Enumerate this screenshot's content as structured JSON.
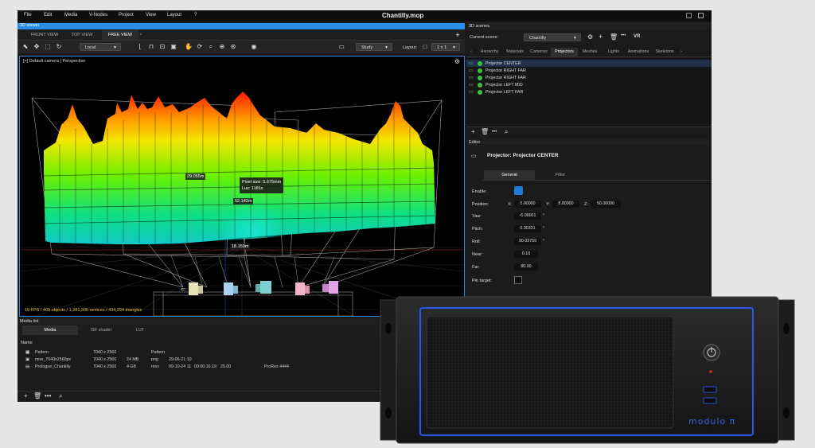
{
  "menu": {
    "items": [
      "File",
      "Edit",
      "Media",
      "V-Nodes",
      "Project",
      "View",
      "Layout",
      "?"
    ],
    "window_title": "Chantilly.mop"
  },
  "viewer": {
    "panel_title": "3D viewer",
    "tabs": [
      "FRONT VIEW",
      "TOP VIEW",
      "FREE VIEW"
    ],
    "space_dropdown": "Local",
    "mode_dropdown": "Study",
    "layout_label": "Layout:",
    "layout_dropdown": "1 x 1",
    "camera_label": "[+] Default camera | Perspective",
    "stats": "19 FPS / 409 objects / 1,281,305 vertices / 434,294 triangles",
    "measures": [
      "29.055m",
      "52.142m",
      "18.159m"
    ],
    "pixel_size": "Pixel size: 5.675mm",
    "lux": "Lux: 1181x"
  },
  "media": {
    "panel_title": "Media list",
    "tabs": [
      "Media",
      "ISF shader",
      "LUT"
    ],
    "col_name": "Name",
    "rows": [
      {
        "name": "Pattern",
        "res": "7040 x 2560",
        "size": "",
        "fmt": "Pattern",
        "date": "",
        "time": "",
        "fps": "",
        "codec": ""
      },
      {
        "name": "mire_7040x2560px",
        "res": "7040 x 2560",
        "size": "24 MB",
        "fmt": "png",
        "date": "29-06-21 10",
        "time": "",
        "fps": "",
        "codec": ""
      },
      {
        "name": "Prologue_Chantilly",
        "res": "7040 x 2560",
        "size": "4 GB",
        "fmt": "mov",
        "date": "09-10-24 11",
        "time": "00:00:16:19",
        "fps": "25.00",
        "codec": "ProRes 4444"
      }
    ]
  },
  "scenes": {
    "panel_title": "3D scenes",
    "current_label": "Current scene:",
    "current_value": "Chantilly",
    "vr_label": "VR",
    "tabs": [
      "Hierarchy",
      "Materials",
      "Cameras",
      "Projectors",
      "Meshes",
      "Lights",
      "Animations",
      "Skeletons"
    ],
    "projectors": [
      "Projector CENTER",
      "Projector RIGHT FAR",
      "Projector RIGHT FAR",
      "Projector LEFT MID",
      "Projector LEFT FAR"
    ]
  },
  "editor": {
    "panel_title": "Editor",
    "title": "Projector: Projector CENTER",
    "tabs": [
      "General",
      "Filter"
    ],
    "enable_label": "Enable:",
    "position_label": "Position:",
    "x_label": "X:",
    "x_value": "0.00000",
    "y_label": "Y:",
    "y_value": "8.80000",
    "z_label": "Z:",
    "z_value": "50.00000",
    "yaw_label": "Yaw:",
    "yaw_value": "-6.08001",
    "pitch_label": "Pitch:",
    "pitch_value": "0.30331",
    "roll_label": "Roll:",
    "roll_value": "90.03759",
    "near_label": "Near:",
    "near_value": "0.10",
    "far_label": "Far:",
    "far_value": "80.00",
    "pin_label": "Pin target:",
    "degree_mark": "°"
  },
  "server": {
    "brand": "modulo π"
  },
  "colors": {
    "accent": "#2a8ee6",
    "status_green": "#3bc43b",
    "stats_yellow": "#e8c33a"
  }
}
